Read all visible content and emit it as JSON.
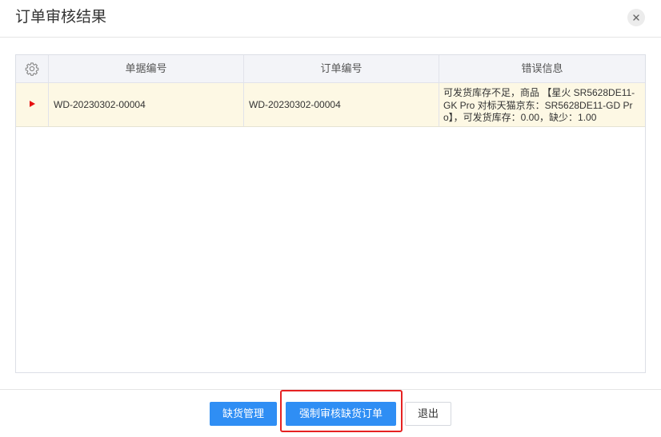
{
  "dialog": {
    "title": "订单审核结果",
    "close_icon": "close-icon"
  },
  "grid": {
    "settings_icon": "gear-icon",
    "columns": [
      "单据编号",
      "订单编号",
      "错误信息"
    ],
    "rows": [
      {
        "indicator_icon": "row-pointer-icon",
        "doc_no": "WD-20230302-00004",
        "order_no": "WD-20230302-00004",
        "error": "可发货库存不足，商品 【星火 SR5628DE11-GK Pro 对标天猫京东：SR5628DE11-GD Pro】，可发货库存：0.00，缺少：1.00"
      }
    ]
  },
  "footer": {
    "shortage_mgmt_label": "缺货管理",
    "force_review_label": "强制审核缺货订单",
    "exit_label": "退出"
  },
  "colors": {
    "primary": "#2f8ef4",
    "selected_row": "#fdf8e4",
    "highlight_border": "#e62222",
    "pointer": "#e61010"
  }
}
